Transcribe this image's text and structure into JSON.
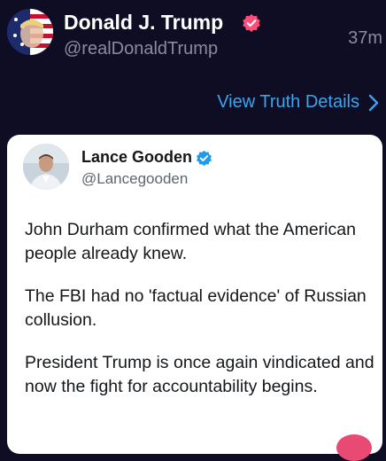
{
  "post": {
    "author_name": "Donald J. Trump",
    "author_handle": "@realDonaldTrump",
    "time": "37m",
    "view_details_label": "View Truth Details"
  },
  "embed": {
    "author_name": "Lance Gooden",
    "author_handle": "@Lancegooden",
    "paragraphs": [
      "John Durham confirmed what the American people already knew.",
      "The FBI had no 'factual evidence' of Russian collusion.",
      "President Trump is once again vindicated and now the fight for accountability begins."
    ]
  },
  "colors": {
    "background": "#0f0d24",
    "link": "#3aa5f0",
    "verified_main": "#ff4d7a",
    "verified_embed": "#1d9bf0"
  }
}
